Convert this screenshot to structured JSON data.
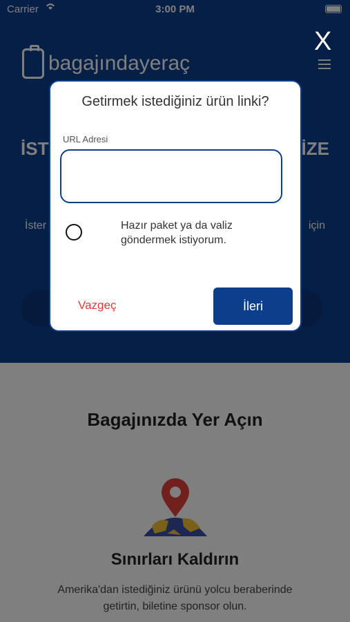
{
  "status_bar": {
    "carrier": "Carrier",
    "time": "3:00 PM"
  },
  "app": {
    "logo_text": "bagajındayeraç"
  },
  "hero": {
    "title_left": "İST",
    "title_right": "İZE",
    "subtitle_left": "İster",
    "subtitle_right": "için"
  },
  "close_label": "X",
  "modal": {
    "title": "Getirmek istediğiniz ürün linki?",
    "url_label": "URL Adresi",
    "url_value": "",
    "option_label": "Hazır paket ya da valiz göndermek istiyorum.",
    "option_selected": false,
    "cancel_label": "Vazgeç",
    "next_label": "İleri"
  },
  "section": {
    "title": "Bagajınızda Yer Açın"
  },
  "feature": {
    "icon": "map-pin-icon",
    "title": "Sınırları Kaldırın",
    "description": "Amerika'dan istediğiniz ürünü yolcu beraberinde getirtin, biletine sponsor olun."
  },
  "colors": {
    "brand": "#0b3f8c",
    "cancel": "#e53935",
    "pin": "#e0403a",
    "globe": "#3b4fa8",
    "land": "#f2c233"
  }
}
